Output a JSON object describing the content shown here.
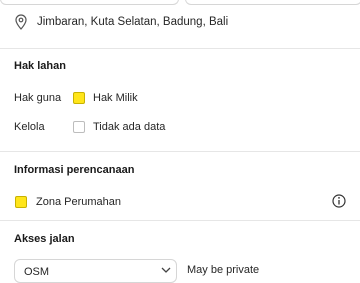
{
  "location": {
    "text": "Jimbaran, Kuta Selatan, Badung, Bali",
    "icon": "location-pin-icon"
  },
  "land_rights": {
    "title": "Hak lahan",
    "rows": [
      {
        "label": "Hak guna",
        "value": "Hak Milik",
        "checked": true
      },
      {
        "label": "Kelola",
        "value": "Tidak ada data",
        "checked": false
      }
    ]
  },
  "planning": {
    "title": "Informasi perencanaan",
    "zone_label": "Zona Perumahan",
    "zone_color": "#ffe51a",
    "info_icon": "info-icon"
  },
  "road_access": {
    "title": "Akses jalan",
    "select_value": "OSM",
    "note": "May be private"
  },
  "colors": {
    "accent_yellow": "#ffe51a",
    "divider": "#e6e6e6"
  }
}
